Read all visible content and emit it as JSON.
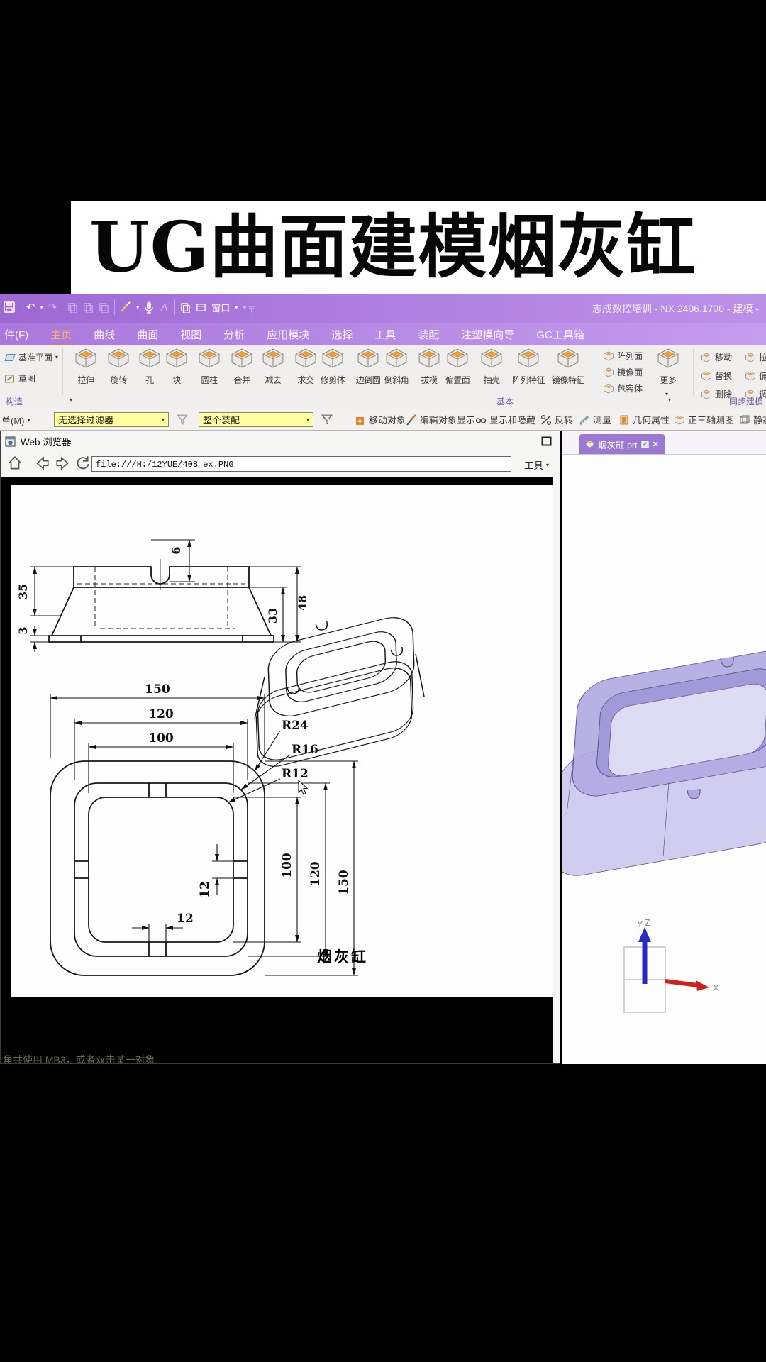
{
  "banner": {
    "title": "UG曲面建模烟灰缸"
  },
  "titlebar": {
    "app_title": "志成数控培训 - NX 2406.1700 - 建模 -",
    "window_label": "窗口"
  },
  "tabs": [
    "件(F)",
    "主页",
    "曲线",
    "曲面",
    "视图",
    "分析",
    "应用模块",
    "选择",
    "工具",
    "装配",
    "注塑模向导",
    "GC工具箱"
  ],
  "ribbon": {
    "datum_plane": "基准平面",
    "sketch": "草图",
    "group_construct": "构造",
    "tools": [
      "拉伸",
      "旋转",
      "孔",
      "块",
      "圆柱",
      "合并",
      "减去",
      "求交",
      "修剪体",
      "边倒圆",
      "倒斜角",
      "拔模",
      "偏置面",
      "抽壳",
      "阵列特征",
      "镜像特征"
    ],
    "stack": [
      "阵列面",
      "镜像面",
      "包容体"
    ],
    "more": "更多",
    "group_basic": "基本",
    "sync": [
      "移动",
      "拉动面",
      "替换",
      "偏置",
      "删除",
      "调整圆角"
    ],
    "group_sync": "同步建模"
  },
  "selbar": {
    "menu": "单(M)",
    "filter_value": "无选择过滤器",
    "scope_value": "整个装配",
    "actions": [
      "移动对象",
      "编辑对象显示",
      "显示和隐藏",
      "反转",
      "测量",
      "几何属性",
      "正三轴测图",
      "静态"
    ]
  },
  "browser": {
    "title": "Web 浏览器",
    "url": "file:///H:/12YUE/408_ex.PNG",
    "tools_label": "工具"
  },
  "part_tab": {
    "label": "烟灰缸.prt"
  },
  "drawing": {
    "d6": "6",
    "d35": "35",
    "d3": "3",
    "d33": "33",
    "d48": "48",
    "t100": "100",
    "t120": "120",
    "t150": "150",
    "r100": "100",
    "r120": "120",
    "r150": "150",
    "r24": "R24",
    "r16": "R16",
    "r12": "R12",
    "g12a": "12",
    "g12b": "12",
    "part_label": "烟灰缸"
  },
  "status": {
    "message": "角共使用 MB3，或者双击某一对象"
  },
  "triad": {
    "x": "X",
    "y": "Y",
    "z": "Z"
  }
}
